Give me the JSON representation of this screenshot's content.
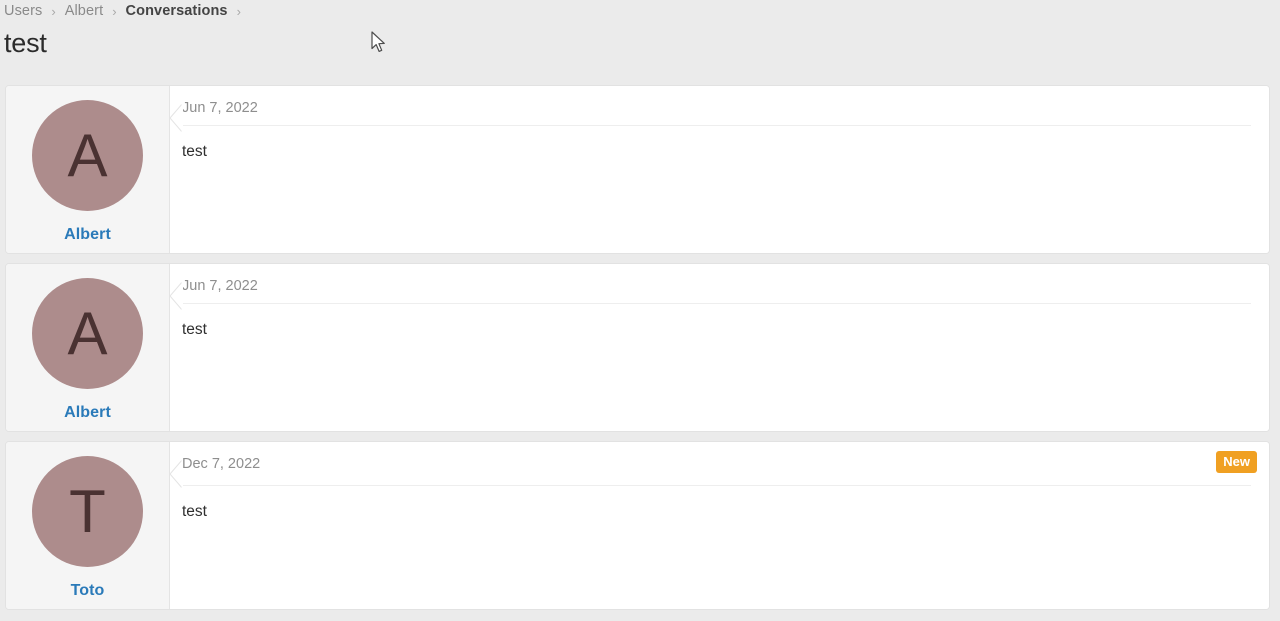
{
  "breadcrumb": {
    "separator": "›",
    "items": [
      {
        "label": "Users",
        "current": false
      },
      {
        "label": "Albert",
        "current": false
      },
      {
        "label": "Conversations",
        "current": true
      }
    ]
  },
  "page": {
    "title": "test"
  },
  "colors": {
    "page_background": "#ebebeb",
    "avatar_background": "#ad8c8c",
    "avatar_letter": "#4a3232",
    "name_link": "#2a7ab9",
    "badge_new": "#f0a022",
    "date_text": "#8e8e8e",
    "message_text": "#2f2f2f"
  },
  "conversations": [
    {
      "avatar_letter": "A",
      "name": "Albert",
      "date": "Jun 7, 2022",
      "message": "test",
      "badge": null
    },
    {
      "avatar_letter": "A",
      "name": "Albert",
      "date": "Jun 7, 2022",
      "message": "test",
      "badge": null
    },
    {
      "avatar_letter": "T",
      "name": "Toto",
      "date": "Dec 7, 2022",
      "message": "test",
      "badge": "New"
    }
  ]
}
